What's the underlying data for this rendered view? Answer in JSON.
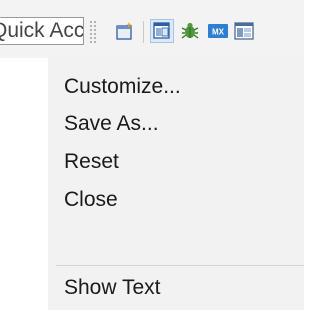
{
  "toolbar": {
    "quick_access_text": "Quick Access",
    "icons": [
      {
        "name": "new-wizard-icon",
        "active": false
      },
      {
        "name": "open-perspective-icon",
        "active": true
      },
      {
        "name": "debug-perspective-icon",
        "active": false
      },
      {
        "name": "mx-icon",
        "label": "MX",
        "active": false
      },
      {
        "name": "perspective-icon",
        "active": false
      }
    ]
  },
  "context_menu": {
    "items": [
      {
        "label": "Customize..."
      },
      {
        "label": "Save As..."
      },
      {
        "label": "Reset"
      },
      {
        "label": "Close"
      },
      {
        "label": "Show Text"
      }
    ]
  },
  "colors": {
    "toolbar_bg": "#f3f3f3",
    "menu_bg": "#f2f2f2",
    "accent": "#2a5ea8"
  }
}
